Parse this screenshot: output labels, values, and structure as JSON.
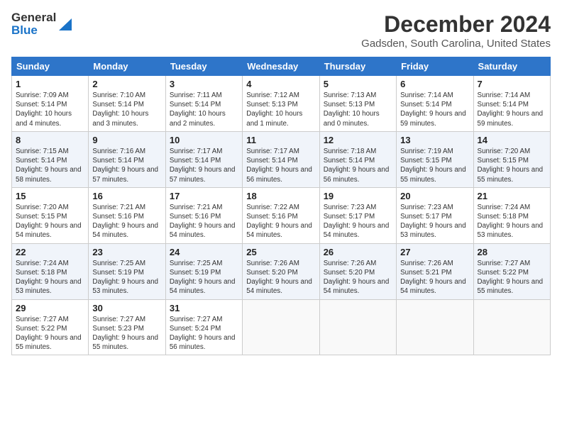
{
  "header": {
    "logo_line1": "General",
    "logo_line2": "Blue",
    "month": "December 2024",
    "location": "Gadsden, South Carolina, United States"
  },
  "days_of_week": [
    "Sunday",
    "Monday",
    "Tuesday",
    "Wednesday",
    "Thursday",
    "Friday",
    "Saturday"
  ],
  "weeks": [
    [
      {
        "day": 1,
        "sunrise": "7:09 AM",
        "sunset": "5:14 PM",
        "daylight": "10 hours and 4 minutes."
      },
      {
        "day": 2,
        "sunrise": "7:10 AM",
        "sunset": "5:14 PM",
        "daylight": "10 hours and 3 minutes."
      },
      {
        "day": 3,
        "sunrise": "7:11 AM",
        "sunset": "5:14 PM",
        "daylight": "10 hours and 2 minutes."
      },
      {
        "day": 4,
        "sunrise": "7:12 AM",
        "sunset": "5:13 PM",
        "daylight": "10 hours and 1 minute."
      },
      {
        "day": 5,
        "sunrise": "7:13 AM",
        "sunset": "5:13 PM",
        "daylight": "10 hours and 0 minutes."
      },
      {
        "day": 6,
        "sunrise": "7:14 AM",
        "sunset": "5:14 PM",
        "daylight": "9 hours and 59 minutes."
      },
      {
        "day": 7,
        "sunrise": "7:14 AM",
        "sunset": "5:14 PM",
        "daylight": "9 hours and 59 minutes."
      }
    ],
    [
      {
        "day": 8,
        "sunrise": "7:15 AM",
        "sunset": "5:14 PM",
        "daylight": "9 hours and 58 minutes."
      },
      {
        "day": 9,
        "sunrise": "7:16 AM",
        "sunset": "5:14 PM",
        "daylight": "9 hours and 57 minutes."
      },
      {
        "day": 10,
        "sunrise": "7:17 AM",
        "sunset": "5:14 PM",
        "daylight": "9 hours and 57 minutes."
      },
      {
        "day": 11,
        "sunrise": "7:17 AM",
        "sunset": "5:14 PM",
        "daylight": "9 hours and 56 minutes."
      },
      {
        "day": 12,
        "sunrise": "7:18 AM",
        "sunset": "5:14 PM",
        "daylight": "9 hours and 56 minutes."
      },
      {
        "day": 13,
        "sunrise": "7:19 AM",
        "sunset": "5:15 PM",
        "daylight": "9 hours and 55 minutes."
      },
      {
        "day": 14,
        "sunrise": "7:20 AM",
        "sunset": "5:15 PM",
        "daylight": "9 hours and 55 minutes."
      }
    ],
    [
      {
        "day": 15,
        "sunrise": "7:20 AM",
        "sunset": "5:15 PM",
        "daylight": "9 hours and 54 minutes."
      },
      {
        "day": 16,
        "sunrise": "7:21 AM",
        "sunset": "5:16 PM",
        "daylight": "9 hours and 54 minutes."
      },
      {
        "day": 17,
        "sunrise": "7:21 AM",
        "sunset": "5:16 PM",
        "daylight": "9 hours and 54 minutes."
      },
      {
        "day": 18,
        "sunrise": "7:22 AM",
        "sunset": "5:16 PM",
        "daylight": "9 hours and 54 minutes."
      },
      {
        "day": 19,
        "sunrise": "7:23 AM",
        "sunset": "5:17 PM",
        "daylight": "9 hours and 54 minutes."
      },
      {
        "day": 20,
        "sunrise": "7:23 AM",
        "sunset": "5:17 PM",
        "daylight": "9 hours and 53 minutes."
      },
      {
        "day": 21,
        "sunrise": "7:24 AM",
        "sunset": "5:18 PM",
        "daylight": "9 hours and 53 minutes."
      }
    ],
    [
      {
        "day": 22,
        "sunrise": "7:24 AM",
        "sunset": "5:18 PM",
        "daylight": "9 hours and 53 minutes."
      },
      {
        "day": 23,
        "sunrise": "7:25 AM",
        "sunset": "5:19 PM",
        "daylight": "9 hours and 53 minutes."
      },
      {
        "day": 24,
        "sunrise": "7:25 AM",
        "sunset": "5:19 PM",
        "daylight": "9 hours and 54 minutes."
      },
      {
        "day": 25,
        "sunrise": "7:26 AM",
        "sunset": "5:20 PM",
        "daylight": "9 hours and 54 minutes."
      },
      {
        "day": 26,
        "sunrise": "7:26 AM",
        "sunset": "5:20 PM",
        "daylight": "9 hours and 54 minutes."
      },
      {
        "day": 27,
        "sunrise": "7:26 AM",
        "sunset": "5:21 PM",
        "daylight": "9 hours and 54 minutes."
      },
      {
        "day": 28,
        "sunrise": "7:27 AM",
        "sunset": "5:22 PM",
        "daylight": "9 hours and 55 minutes."
      }
    ],
    [
      {
        "day": 29,
        "sunrise": "7:27 AM",
        "sunset": "5:22 PM",
        "daylight": "9 hours and 55 minutes."
      },
      {
        "day": 30,
        "sunrise": "7:27 AM",
        "sunset": "5:23 PM",
        "daylight": "9 hours and 55 minutes."
      },
      {
        "day": 31,
        "sunrise": "7:27 AM",
        "sunset": "5:24 PM",
        "daylight": "9 hours and 56 minutes."
      },
      null,
      null,
      null,
      null
    ]
  ]
}
